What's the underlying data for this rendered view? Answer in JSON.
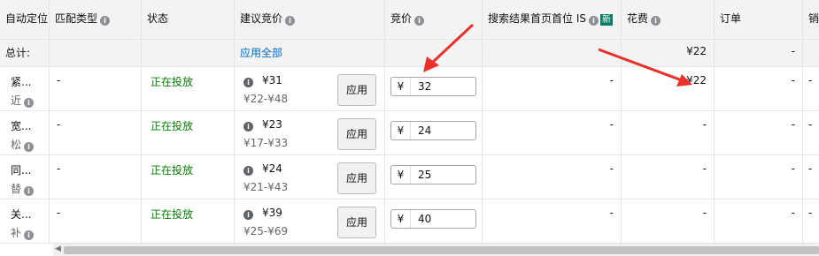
{
  "headers": {
    "targeting": "自动定位",
    "match_type": "匹配类型",
    "status": "状态",
    "suggested_bid": "建议竞价",
    "bid": "竞价",
    "top_of_search": "搜索结果首页首位 IS",
    "new_badge": "新",
    "spend": "花费",
    "orders": "订单",
    "cut": "销"
  },
  "summary": {
    "label": "总计:",
    "apply_all": "应用全部",
    "spend": "¥22",
    "orders": "-"
  },
  "rows": [
    {
      "t1": "紧...",
      "t2": "近",
      "match": "-",
      "status": "正在投放",
      "sug": "¥31",
      "range": "¥22-¥48",
      "apply": "应用",
      "cur": "¥",
      "bid": "32",
      "top": "-",
      "spend": "¥22",
      "orders": "-",
      "cut": "-"
    },
    {
      "t1": "宽...",
      "t2": "松",
      "match": "-",
      "status": "正在投放",
      "sug": "¥23",
      "range": "¥17-¥33",
      "apply": "应用",
      "cur": "¥",
      "bid": "24",
      "top": "-",
      "spend": "-",
      "orders": "-",
      "cut": "-"
    },
    {
      "t1": "同...",
      "t2": "替",
      "match": "-",
      "status": "正在投放",
      "sug": "¥24",
      "range": "¥21-¥43",
      "apply": "应用",
      "cur": "¥",
      "bid": "25",
      "top": "-",
      "spend": "-",
      "orders": "-",
      "cut": "-"
    },
    {
      "t1": "关...",
      "t2": "补",
      "match": "-",
      "status": "正在投放",
      "sug": "¥39",
      "range": "¥25-¥69",
      "apply": "应用",
      "cur": "¥",
      "bid": "40",
      "top": "-",
      "spend": "-",
      "orders": "-",
      "cut": "-"
    }
  ],
  "colors": {
    "arrow": "#e8312a",
    "status_green": "#067d06",
    "link_blue": "#0066c0"
  }
}
